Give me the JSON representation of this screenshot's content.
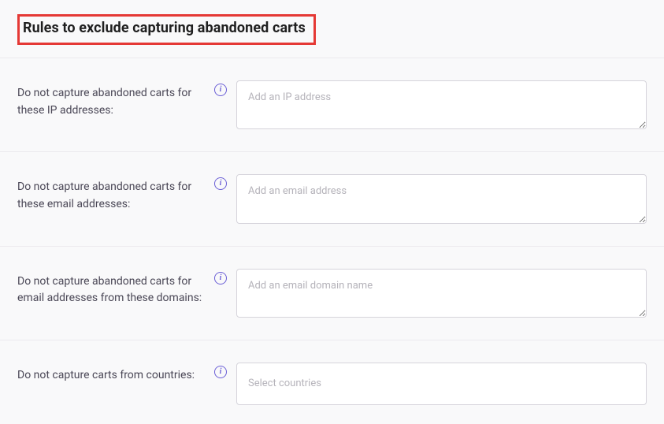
{
  "section": {
    "title": "Rules to exclude capturing abandoned carts"
  },
  "rows": {
    "ip": {
      "label": "Do not capture abandoned carts for these IP addresses:",
      "placeholder": "Add an IP address",
      "value": ""
    },
    "email": {
      "label": "Do not capture abandoned carts for these email addresses:",
      "placeholder": "Add an email address",
      "value": ""
    },
    "domain": {
      "label": "Do not capture abandoned carts for email addresses from these domains:",
      "placeholder": "Add an email domain name",
      "value": ""
    },
    "country": {
      "label": "Do not capture carts from countries:",
      "placeholder": "Select countries",
      "value": ""
    }
  }
}
